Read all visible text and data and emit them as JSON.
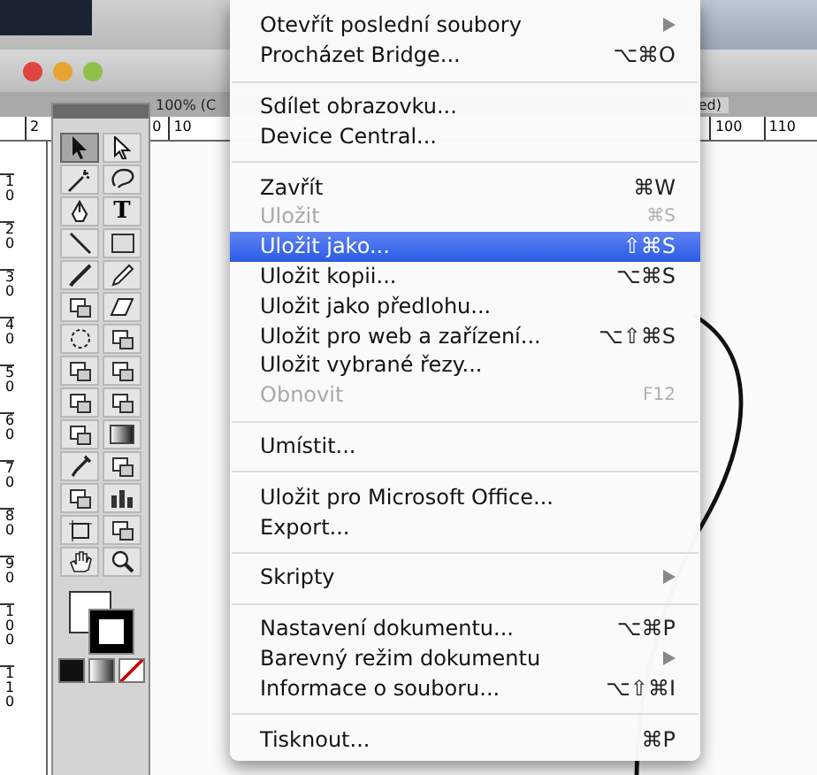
{
  "document_tab": {
    "left_label": "100% (C",
    "right_label": "ed)"
  },
  "top_ruler": {
    "left_labels": [
      "2",
      "0",
      "10"
    ],
    "right_labels": [
      "100",
      "110"
    ]
  },
  "left_ruler": {
    "labels": [
      "10",
      "20",
      "30",
      "40",
      "50",
      "60",
      "70",
      "80",
      "90",
      "100",
      "110"
    ]
  },
  "tools": [
    {
      "kind": "arrow",
      "selected": true
    },
    {
      "kind": "hollow-arrow",
      "selected": false
    },
    {
      "kind": "wand",
      "selected": false
    },
    {
      "kind": "lasso",
      "selected": false
    },
    {
      "kind": "pen",
      "selected": false
    },
    {
      "kind": "type",
      "label": "T",
      "selected": false
    },
    {
      "kind": "line",
      "selected": false
    },
    {
      "kind": "rect",
      "selected": false
    },
    {
      "kind": "brush",
      "selected": false
    },
    {
      "kind": "pencil",
      "selected": false
    },
    {
      "kind": "blob",
      "selected": false
    },
    {
      "kind": "eraser",
      "selected": false
    },
    {
      "kind": "rotate",
      "selected": false
    },
    {
      "kind": "scale",
      "selected": false
    },
    {
      "kind": "warp",
      "selected": false
    },
    {
      "kind": "transform",
      "selected": false
    },
    {
      "kind": "spray",
      "selected": false
    },
    {
      "kind": "graph",
      "selected": false
    },
    {
      "kind": "mesh",
      "selected": false
    },
    {
      "kind": "gradient",
      "selected": false
    },
    {
      "kind": "eyedropper",
      "selected": false
    },
    {
      "kind": "blend",
      "selected": false
    },
    {
      "kind": "symbol",
      "selected": false
    },
    {
      "kind": "bars",
      "selected": false
    },
    {
      "kind": "artboard",
      "selected": false
    },
    {
      "kind": "knife",
      "selected": false
    },
    {
      "kind": "hand",
      "selected": false
    },
    {
      "kind": "zoom",
      "selected": false
    }
  ],
  "menu": {
    "items": [
      {
        "kind": "item",
        "label": "Otevřít poslední soubory",
        "submenu": true,
        "disabled": false,
        "selected": false
      },
      {
        "kind": "item",
        "label": "Procházet Bridge...",
        "shortcut": "⌥⌘O",
        "disabled": false,
        "selected": false
      },
      {
        "kind": "separator"
      },
      {
        "kind": "item",
        "label": "Sdílet obrazovku...",
        "disabled": false,
        "selected": false
      },
      {
        "kind": "item",
        "label": "Device Central...",
        "disabled": false,
        "selected": false
      },
      {
        "kind": "separator"
      },
      {
        "kind": "item",
        "label": "Zavřít",
        "shortcut": "⌘W",
        "disabled": false,
        "selected": false
      },
      {
        "kind": "item",
        "label": "Uložit",
        "shortcut": "⌘S",
        "disabled": true,
        "selected": false
      },
      {
        "kind": "item",
        "label": "Uložit jako...",
        "shortcut": "⇧⌘S",
        "disabled": false,
        "selected": true
      },
      {
        "kind": "item",
        "label": "Uložit kopii...",
        "shortcut": "⌥⌘S",
        "disabled": false,
        "selected": false
      },
      {
        "kind": "item",
        "label": "Uložit jako předlohu...",
        "disabled": false,
        "selected": false
      },
      {
        "kind": "item",
        "label": "Uložit pro web a zařízení...",
        "shortcut": "⌥⇧⌘S",
        "disabled": false,
        "selected": false
      },
      {
        "kind": "item",
        "label": "Uložit vybrané řezy...",
        "disabled": false,
        "selected": false
      },
      {
        "kind": "item",
        "label": "Obnovit",
        "shortcut": "F12",
        "disabled": true,
        "selected": false
      },
      {
        "kind": "separator"
      },
      {
        "kind": "item",
        "label": "Umístit...",
        "disabled": false,
        "selected": false
      },
      {
        "kind": "separator"
      },
      {
        "kind": "item",
        "label": "Uložit pro Microsoft Office...",
        "disabled": false,
        "selected": false
      },
      {
        "kind": "item",
        "label": "Export...",
        "disabled": false,
        "selected": false
      },
      {
        "kind": "separator"
      },
      {
        "kind": "item",
        "label": "Skripty",
        "submenu": true,
        "disabled": false,
        "selected": false
      },
      {
        "kind": "separator"
      },
      {
        "kind": "item",
        "label": "Nastavení dokumentu...",
        "shortcut": "⌥⌘P",
        "disabled": false,
        "selected": false
      },
      {
        "kind": "item",
        "label": "Barevný režim dokumentu",
        "submenu": true,
        "disabled": false,
        "selected": false
      },
      {
        "kind": "item",
        "label": "Informace o souboru...",
        "shortcut": "⌥⇧⌘I",
        "disabled": false,
        "selected": false
      },
      {
        "kind": "separator"
      },
      {
        "kind": "item",
        "label": "Tisknout...",
        "shortcut": "⌘P",
        "disabled": false,
        "selected": false
      }
    ]
  }
}
